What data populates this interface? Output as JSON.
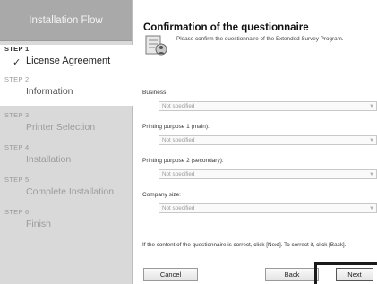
{
  "sidebar": {
    "header": "Installation Flow",
    "steps": [
      {
        "num": "STEP 1",
        "name": "License Agreement"
      },
      {
        "num": "STEP 2",
        "name": "Information"
      },
      {
        "num": "STEP 3",
        "name": "Printer Selection"
      },
      {
        "num": "STEP 4",
        "name": "Installation"
      },
      {
        "num": "STEP 5",
        "name": "Complete Installation"
      },
      {
        "num": "STEP 6",
        "name": "Finish"
      }
    ]
  },
  "main": {
    "title": "Confirmation of the questionnaire",
    "subtitle": "Please confirm the questionnaire of the Extended Survey Program.",
    "fields": [
      {
        "label": "Business:",
        "value": "Not specified"
      },
      {
        "label": "Printing purpose 1 (main):",
        "value": "Not specified"
      },
      {
        "label": "Printing purpose 2 (secondary):",
        "value": "Not specified"
      },
      {
        "label": "Company size:",
        "value": "Not specified"
      }
    ],
    "confirm_text": "If the content of the questionnaire is correct, click [Next]. To correct it, click [Back]."
  },
  "buttons": {
    "cancel": "Cancel",
    "back": "Back",
    "next": "Next"
  },
  "icons": {
    "check": "checkmark-icon",
    "questionnaire": "questionnaire-icon",
    "dropdown": "chevron-down-icon"
  },
  "colors": {
    "sidebar_bg": "#d9d9d9",
    "sidebar_header_bg": "#a9a9a9",
    "active_step_bg": "#ffffff"
  }
}
